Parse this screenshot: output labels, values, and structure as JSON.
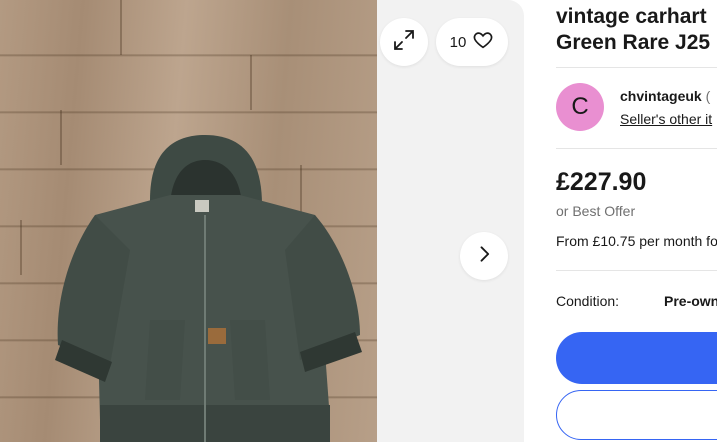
{
  "listing": {
    "title_line1": "vintage carhart",
    "title_line2": "Green Rare J25"
  },
  "gallery": {
    "watch_count": "10",
    "icons": {
      "expand": "expand-icon",
      "watch": "heart-icon",
      "next": "chevron-right-icon"
    }
  },
  "seller": {
    "avatar_letter": "C",
    "avatar_color": "#e98fd1",
    "name": "chvintageuk",
    "name_suffix": "(",
    "other_items_link": "Seller's other it"
  },
  "pricing": {
    "price": "£227.90",
    "best_offer": "or Best Offer",
    "monthly": "From £10.75 per month fo"
  },
  "details": {
    "condition_label": "Condition:",
    "condition_value": "Pre-own"
  },
  "colors": {
    "accent": "#3665f3",
    "text": "#191919",
    "muted": "#707070"
  }
}
